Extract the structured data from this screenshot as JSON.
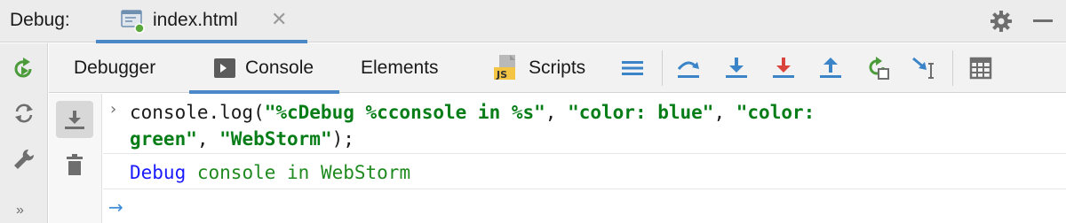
{
  "titlebar": {
    "debug_label": "Debug:",
    "tab_label": "index.html",
    "close_glyph": "✕"
  },
  "toolbar": {
    "tabs": [
      {
        "label": "Debugger"
      },
      {
        "label": "Console",
        "active": true
      },
      {
        "label": "Elements"
      },
      {
        "label": "Scripts"
      }
    ],
    "icons": [
      "frames-icon",
      "step-over-icon",
      "step-into-icon",
      "force-step-into-icon",
      "step-out-icon",
      "restart-frame-icon",
      "run-to-cursor-icon",
      "evaluate-table-icon"
    ]
  },
  "rail": {
    "icons": [
      "rerun-icon",
      "refresh-icon",
      "wrench-icon"
    ],
    "more_glyph": "»"
  },
  "console": {
    "cmd_line1": [
      {
        "t": "console.log(",
        "k": "plain"
      },
      {
        "t": "\"%cDebug %cconsole in %s\"",
        "k": "str"
      },
      {
        "t": ", ",
        "k": "plain"
      },
      {
        "t": "\"color: blue\"",
        "k": "str"
      },
      {
        "t": ", ",
        "k": "plain"
      },
      {
        "t": "\"color:",
        "k": "str"
      }
    ],
    "cmd_line2": [
      {
        "t": "green\"",
        "k": "str"
      },
      {
        "t": ", ",
        "k": "plain"
      },
      {
        "t": "\"WebStorm\"",
        "k": "str"
      },
      {
        "t": ");",
        "k": "plain"
      }
    ],
    "output": {
      "part1": "Debug",
      "part2": "console in WebStorm"
    },
    "chevron": "›",
    "prompt": "→"
  },
  "colors": {
    "accent": "#4a88c7",
    "string": "#067d17",
    "output_blue": "#1a1aff",
    "output_green": "#1f8a1f"
  }
}
